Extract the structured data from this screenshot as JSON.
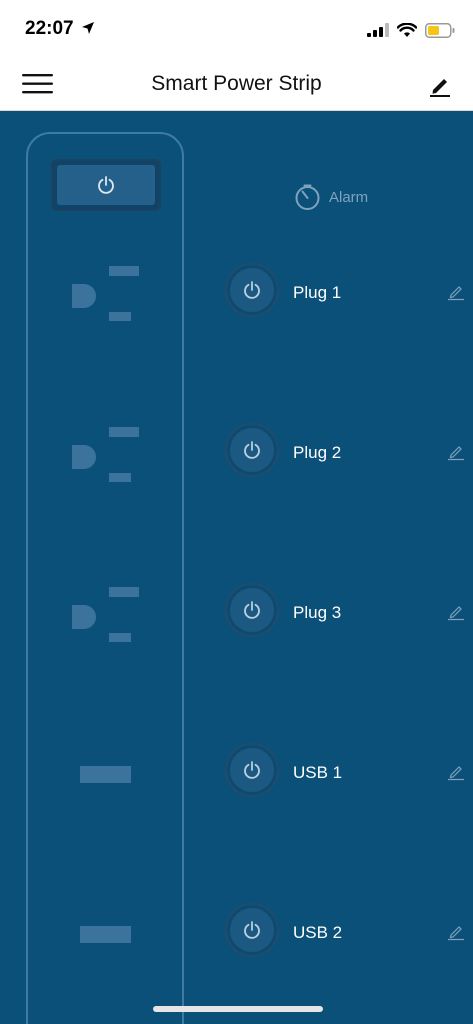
{
  "status_bar": {
    "time": "22:07"
  },
  "header": {
    "title": "Smart Power Strip"
  },
  "alarm": {
    "label": "Alarm"
  },
  "outlets": [
    {
      "label": "Plug 1",
      "type": "plug"
    },
    {
      "label": "Plug 2",
      "type": "plug"
    },
    {
      "label": "Plug 3",
      "type": "plug"
    },
    {
      "label": "USB 1",
      "type": "usb"
    },
    {
      "label": "USB 2",
      "type": "usb"
    }
  ],
  "colors": {
    "background": "#0a5079",
    "strip_outline": "#3f7aa0",
    "socket": "#3b739c",
    "battery": "#f5c518"
  },
  "icons": {
    "menu": "hamburger-icon",
    "edit": "pencil-icon",
    "power": "power-icon",
    "alarm": "timer-icon"
  }
}
